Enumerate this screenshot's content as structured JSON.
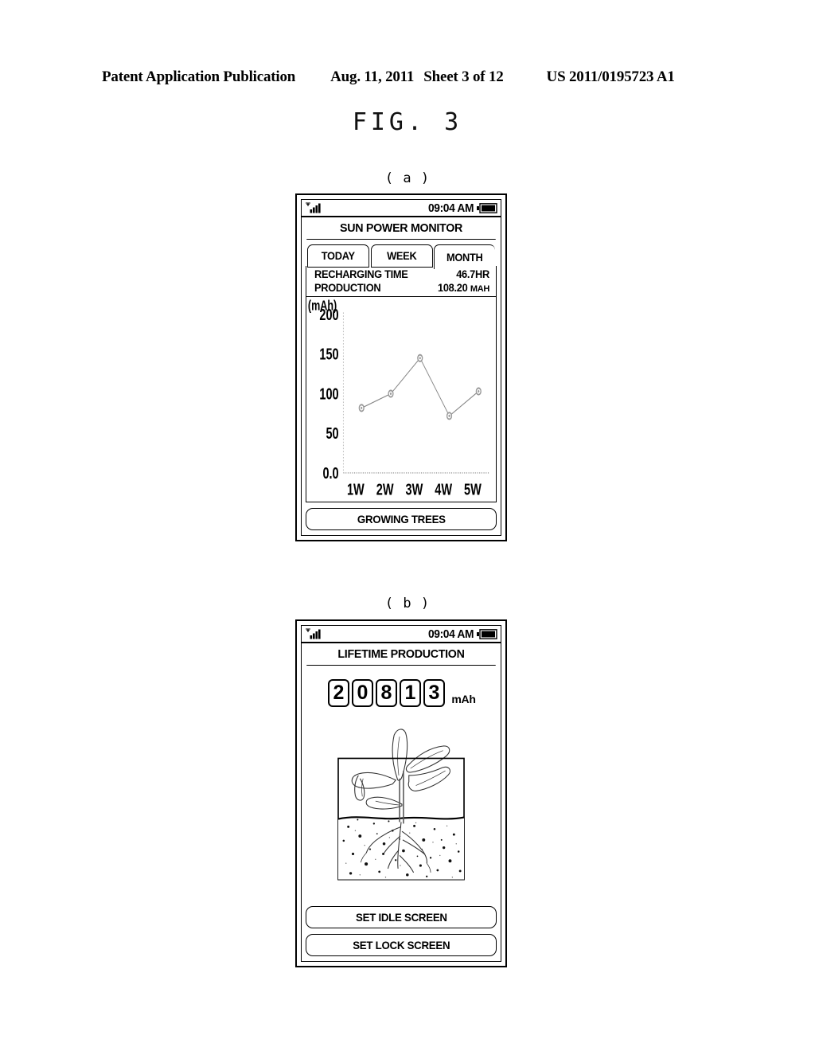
{
  "header": {
    "publication": "Patent Application Publication",
    "date": "Aug. 11, 2011",
    "sheet": "Sheet 3 of 12",
    "number": "US 2011/0195723 A1"
  },
  "figure": {
    "title": "FIG. 3",
    "label_a": "( a )",
    "label_b": "( b )"
  },
  "screen_a": {
    "status": {
      "signal_icon": "signal-bars-icon",
      "time": "09:04 AM",
      "battery_icon": "battery-full-icon"
    },
    "title": "SUN POWER MONITOR",
    "tabs": [
      {
        "label": "TODAY",
        "active": false
      },
      {
        "label": "WEEK",
        "active": false
      },
      {
        "label": "MONTH",
        "active": true
      }
    ],
    "info": [
      {
        "label": "RECHARGING TIME",
        "value": "46.7HR",
        "unit": ""
      },
      {
        "label": "PRODUCTION",
        "value": "108.20",
        "unit": "MAH"
      }
    ],
    "button": "GROWING TREES"
  },
  "screen_b": {
    "status": {
      "signal_icon": "signal-bars-icon",
      "time": "09:04 AM",
      "battery_icon": "battery-full-icon"
    },
    "title": "LIFETIME PRODUCTION",
    "counter": {
      "digits": [
        "2",
        "0",
        "8",
        "1",
        "3"
      ],
      "unit": "mAh"
    },
    "illustration": "growing-plant-seedling",
    "buttons": [
      {
        "label": "SET IDLE SCREEN"
      },
      {
        "label": "SET LOCK SCREEN"
      }
    ]
  },
  "chart_data": {
    "type": "line",
    "title": "",
    "xlabel": "",
    "ylabel": "(mAh)",
    "categories": [
      "1W",
      "2W",
      "3W",
      "4W",
      "5W"
    ],
    "values": [
      82,
      100,
      145,
      72,
      103
    ],
    "ytick_labels": [
      "0.0",
      "50",
      "100",
      "150",
      "200"
    ],
    "ytick_values": [
      0,
      50,
      100,
      150,
      200
    ],
    "ylim": [
      0,
      200
    ],
    "grid": false,
    "legend": "none",
    "marker": "circle",
    "line_color": "#888888",
    "marker_color": "#999999"
  }
}
